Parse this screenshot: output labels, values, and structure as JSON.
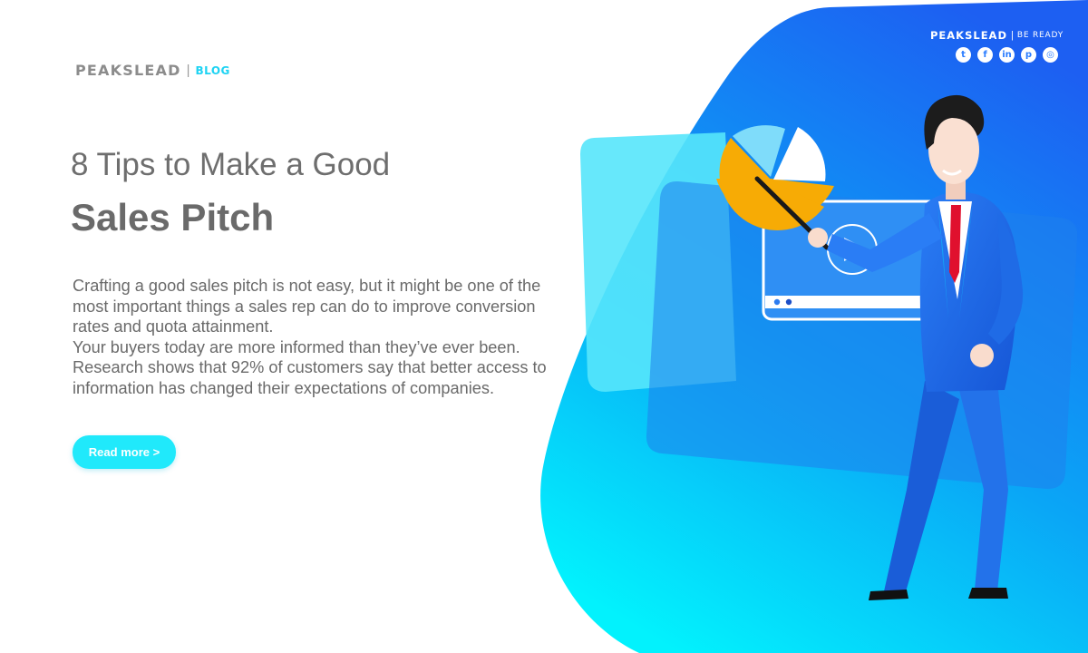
{
  "brand": {
    "name": "PEAKSLEAD",
    "separator": "|",
    "section": "BLOG"
  },
  "brand_top": {
    "name": "PEAKSLEAD",
    "separator": "|",
    "tagline": "BE READY"
  },
  "social": [
    {
      "name": "twitter",
      "glyph": "t"
    },
    {
      "name": "facebook",
      "glyph": "f"
    },
    {
      "name": "linkedin",
      "glyph": "in"
    },
    {
      "name": "pinterest",
      "glyph": "p"
    },
    {
      "name": "instagram",
      "glyph": "◎"
    }
  ],
  "article": {
    "title_line1": "8 Tips to Make a Good",
    "title_line2": "Sales Pitch",
    "paragraph1": "Crafting a good sales pitch is not easy, but it might be one of the most important things a sales rep can do to improve conversion rates and quota attainment.",
    "paragraph2": "Your buyers today are more informed than they’ve ever been. Research shows that 92% of customers say that better access to information has changed their expectations of companies.",
    "cta": "Read more >"
  },
  "colors": {
    "accent": "#20e9fb",
    "blue_dark": "#1767f0",
    "blue_light": "#07f3fd",
    "text": "#6a6a6a"
  }
}
